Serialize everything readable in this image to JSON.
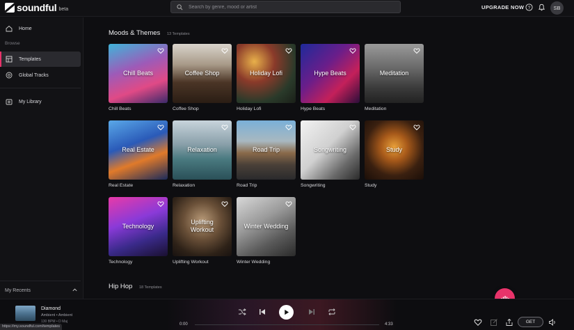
{
  "app": {
    "name": "soundful",
    "badge": "beta"
  },
  "search": {
    "placeholder": "Search by genre, mood or artist"
  },
  "topbar": {
    "upgrade": "UPGRADE NOW",
    "avatar_initials": "SB",
    "icons": [
      "help-icon",
      "bell-icon"
    ]
  },
  "sidebar": {
    "home": "Home",
    "browse_section": "Browse",
    "templates": "Templates",
    "global_tracks": "Global Tracks",
    "my_library": "My Library",
    "my_recents": "My Recents",
    "accent_color": "#e8336a"
  },
  "moods": {
    "title": "Moods & Themes",
    "count": "13 Templates",
    "cards": [
      {
        "label": "Chill Beats",
        "caption": "Chill Beats"
      },
      {
        "label": "Coffee Shop",
        "caption": "Coffee Shop"
      },
      {
        "label": "Holiday Lofi",
        "caption": "Holiday Lofi"
      },
      {
        "label": "Hype Beats",
        "caption": "Hype Beats"
      },
      {
        "label": "Meditation",
        "caption": "Meditation"
      },
      {
        "label": "Real Estate",
        "caption": "Real Estate"
      },
      {
        "label": "Relaxation",
        "caption": "Relaxation"
      },
      {
        "label": "Road Trip",
        "caption": "Road Trip"
      },
      {
        "label": "Songwriting",
        "caption": "Songwriting"
      },
      {
        "label": "Study",
        "caption": "Study"
      },
      {
        "label": "Technology",
        "caption": "Technology"
      },
      {
        "label": "Uplifting\nWorkout",
        "caption": "Uplifting Workout"
      },
      {
        "label": "Winter Wedding",
        "caption": "Winter Wedding"
      }
    ]
  },
  "hiphop": {
    "title": "Hip Hop",
    "count": "18 Templates"
  },
  "player": {
    "title": "Diamond",
    "subtitle": "Ambient • Ambient",
    "meta": "130 BPM • D Maj",
    "time_current": "0:00",
    "time_total": "4:33",
    "get_label": "GET"
  },
  "status_url": "https://my.soundful.com/templates"
}
